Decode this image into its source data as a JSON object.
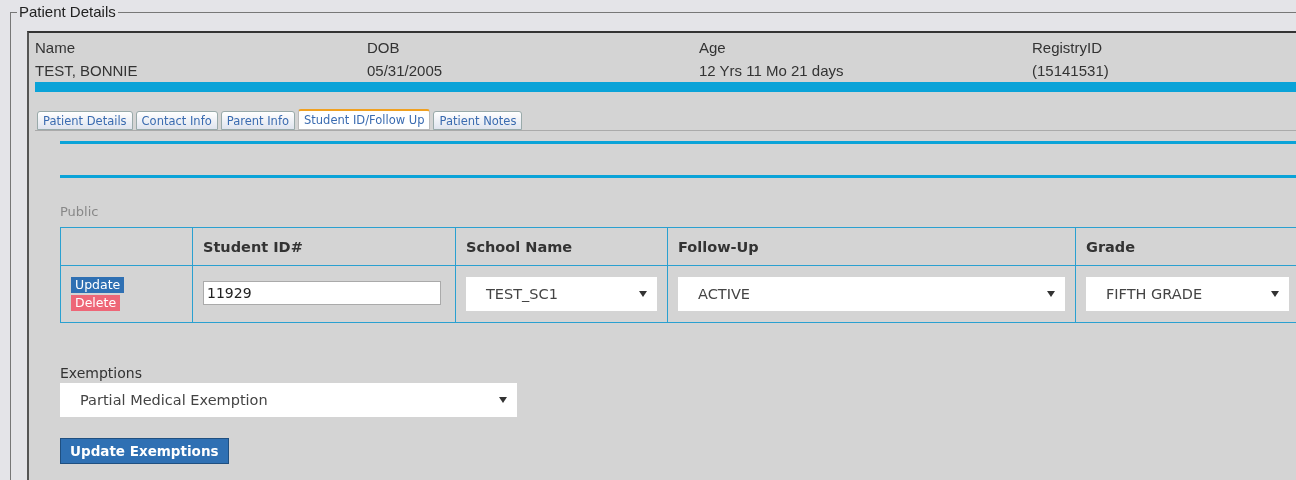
{
  "fieldset": {
    "legend": "Patient Details"
  },
  "patient": [
    {
      "label": "Name",
      "value": "TEST, BONNIE"
    },
    {
      "label": "DOB",
      "value": "05/31/2005"
    },
    {
      "label": "Age",
      "value": "12 Yrs 11 Mo 21 days"
    },
    {
      "label": "RegistryID",
      "value": "(15141531)"
    }
  ],
  "tabs": [
    {
      "label": "Patient Details",
      "selected": false
    },
    {
      "label": "Contact Info",
      "selected": false
    },
    {
      "label": "Parent Info",
      "selected": false
    },
    {
      "label": "Student ID/Follow Up",
      "selected": true
    },
    {
      "label": "Patient Notes",
      "selected": false
    }
  ],
  "section_label": "Public",
  "table": {
    "columns": [
      "Student ID#",
      "School Name",
      "Follow-Up",
      "Grade"
    ],
    "rows": [
      {
        "actions": [
          {
            "kind": "update",
            "label": "Update"
          },
          {
            "kind": "delete",
            "label": "Delete"
          }
        ],
        "cells": [
          {
            "kind": "input",
            "value": "11929"
          },
          {
            "kind": "select",
            "value": "TEST_SC1"
          },
          {
            "kind": "select",
            "value": "ACTIVE"
          },
          {
            "kind": "select",
            "value": "FIFTH GRADE"
          }
        ]
      }
    ]
  },
  "exemptions": {
    "label": "Exemptions",
    "value": "Partial Medical Exemption"
  },
  "update_button": "Update Exemptions"
}
